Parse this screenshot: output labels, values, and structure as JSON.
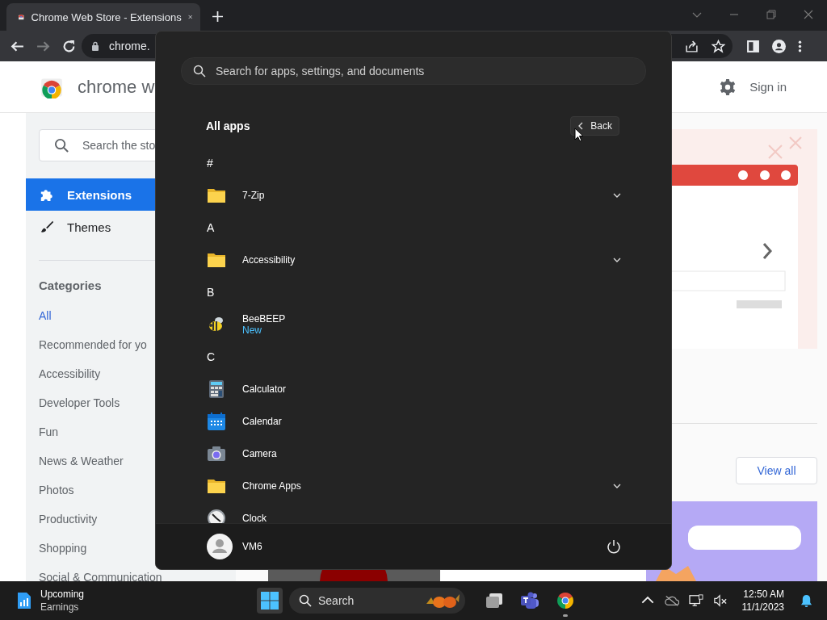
{
  "browser": {
    "tabs": [
      {
        "title": "Chrome Web Store - Extensions",
        "selected": true
      }
    ],
    "forward": {
      "disabled": true
    },
    "address": "chrome."
  },
  "store": {
    "brand": "chrome w",
    "search_placeholder": "Search the sto",
    "sign_in": "Sign in",
    "nav": [
      {
        "label": "Extensions",
        "selected": true
      },
      {
        "label": "Themes",
        "selected": false
      }
    ],
    "categories_heading": "Categories",
    "categories": [
      {
        "label": "All",
        "selected": true
      },
      {
        "label": "Recommended for yo",
        "selected": false
      },
      {
        "label": "Accessibility",
        "selected": false
      },
      {
        "label": "Developer Tools",
        "selected": false
      },
      {
        "label": "Fun",
        "selected": false
      },
      {
        "label": "News & Weather",
        "selected": false
      },
      {
        "label": "Photos",
        "selected": false
      },
      {
        "label": "Productivity",
        "selected": false
      },
      {
        "label": "Shopping",
        "selected": false
      },
      {
        "label": "Social & Communication",
        "selected": false
      }
    ],
    "view_all": "View all"
  },
  "start_menu": {
    "search_placeholder": "Search for apps, settings, and documents",
    "heading": "All apps",
    "back": "Back",
    "items": [
      {
        "kind": "letter",
        "label": "#"
      },
      {
        "kind": "folder",
        "label": "7-Zip",
        "expanded": false
      },
      {
        "kind": "letter",
        "label": "A"
      },
      {
        "kind": "folder",
        "label": "Accessibility",
        "expanded": false
      },
      {
        "kind": "letter",
        "label": "B"
      },
      {
        "kind": "app",
        "label": "BeeBEEP",
        "badge": "New"
      },
      {
        "kind": "letter",
        "label": "C"
      },
      {
        "kind": "app",
        "label": "Calculator"
      },
      {
        "kind": "app",
        "label": "Calendar"
      },
      {
        "kind": "app",
        "label": "Camera"
      },
      {
        "kind": "folder",
        "label": "Chrome Apps",
        "expanded": false
      },
      {
        "kind": "app",
        "label": "Clock"
      }
    ],
    "user": "VM6"
  },
  "taskbar": {
    "widget": {
      "title": "Upcoming",
      "subtitle": "Earnings"
    },
    "search": "Search",
    "pinned": [
      {
        "kind": "taskview",
        "running": false
      },
      {
        "kind": "teams",
        "running": false
      },
      {
        "kind": "chrome",
        "running": true
      }
    ],
    "time": "12:50 AM",
    "date": "11/1/2023"
  }
}
